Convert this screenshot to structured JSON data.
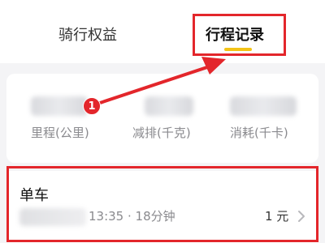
{
  "tabs": {
    "rights_label": "骑行权益",
    "records_label": "行程记录",
    "active": "行程记录",
    "active_indicator_color": "#f3c316"
  },
  "stats": {
    "labels": [
      "里程(公里)",
      "减排(千克)",
      "消耗(千卡)"
    ]
  },
  "annotation": {
    "marker_number": "1",
    "color": "#e3262b"
  },
  "trip": {
    "title": "单车",
    "time_duration": "13:35 · 18分钟",
    "price": "1 元",
    "chevron_icon": "chevron-right-icon"
  }
}
